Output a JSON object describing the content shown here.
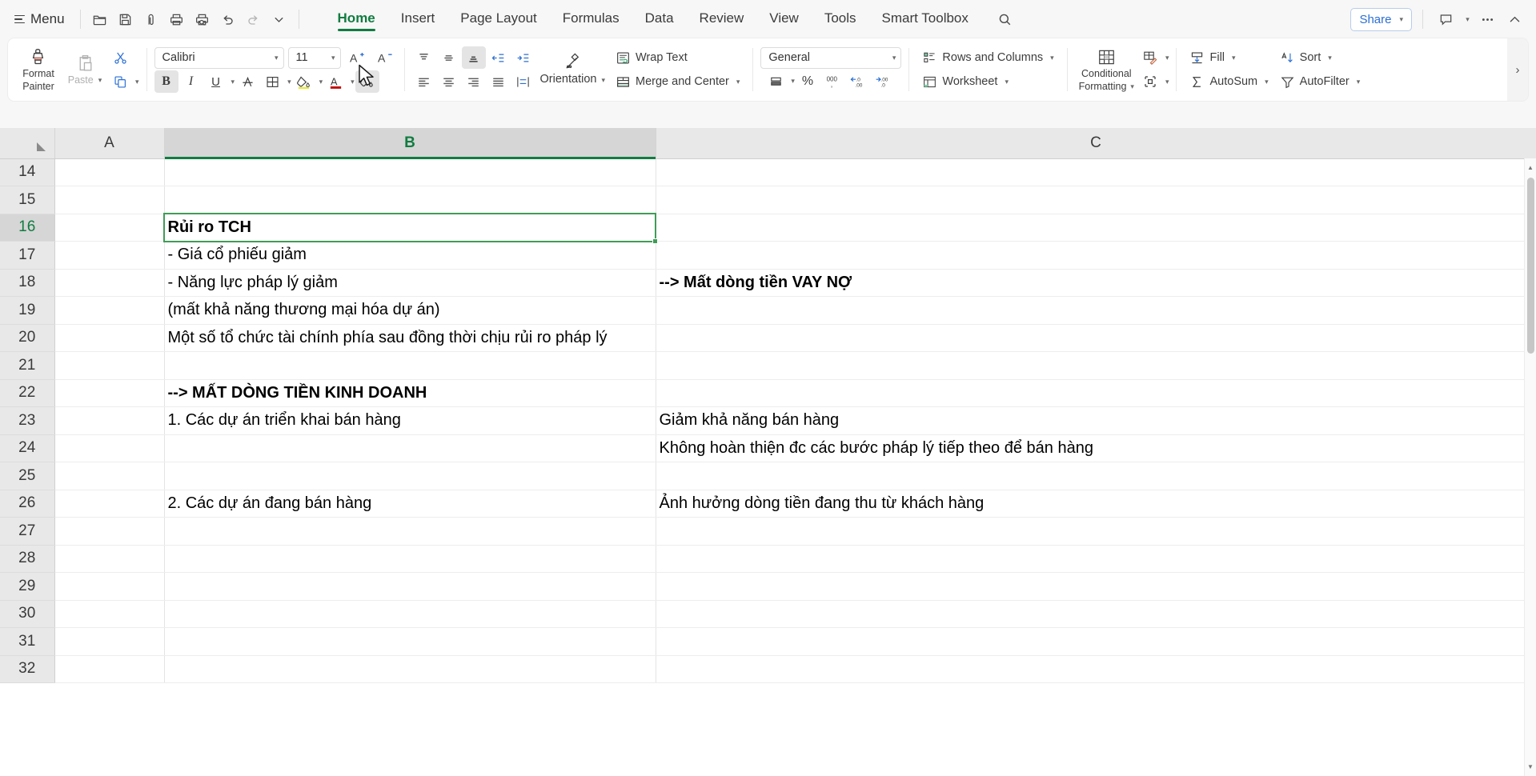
{
  "app": {
    "menu_label": "Menu",
    "share_label": "Share"
  },
  "quick_access": [
    {
      "name": "open-icon",
      "title": "Open"
    },
    {
      "name": "save-icon",
      "title": "Save"
    },
    {
      "name": "output-icon",
      "title": "Output as PDF"
    },
    {
      "name": "print-icon",
      "title": "Print"
    },
    {
      "name": "print-preview-icon",
      "title": "Print Preview"
    },
    {
      "name": "undo-icon",
      "title": "Undo"
    },
    {
      "name": "redo-icon",
      "title": "Redo"
    },
    {
      "name": "customize-icon",
      "title": "Customize Quick Access Toolbar"
    }
  ],
  "tabs": [
    {
      "label": "Home",
      "active": true
    },
    {
      "label": "Insert",
      "active": false
    },
    {
      "label": "Page Layout",
      "active": false
    },
    {
      "label": "Formulas",
      "active": false
    },
    {
      "label": "Data",
      "active": false
    },
    {
      "label": "Review",
      "active": false
    },
    {
      "label": "View",
      "active": false
    },
    {
      "label": "Tools",
      "active": false
    },
    {
      "label": "Smart Toolbox",
      "active": false
    }
  ],
  "ribbon": {
    "format_painter": "Format\nPainter",
    "format_painter_line1": "Format",
    "format_painter_line2": "Painter",
    "paste_label": "Paste",
    "font_name": "Calibri",
    "font_size": "11",
    "wrap_text": "Wrap Text",
    "orientation": "Orientation",
    "merge_and_center": "Merge and Center",
    "number_format": "General",
    "rows_and_columns": "Rows and Columns",
    "worksheet": "Worksheet",
    "conditional_formatting_line1": "Conditional",
    "conditional_formatting_line2": "Formatting",
    "fill": "Fill",
    "autosum": "AutoSum",
    "sort": "Sort",
    "autofilter": "AutoFilter",
    "expand_more": "›"
  },
  "sheet": {
    "columns": [
      "A",
      "B",
      "C"
    ],
    "selected_column": "B",
    "active_cell": "B16",
    "rows": [
      {
        "num": "14",
        "a": "",
        "b": "",
        "c": ""
      },
      {
        "num": "15",
        "a": "",
        "b": "",
        "c": ""
      },
      {
        "num": "16",
        "a": "",
        "b": "Rủi ro TCH",
        "c": "",
        "b_bold": true,
        "active": true
      },
      {
        "num": "17",
        "a": "",
        "b": "- Giá cổ phiếu giảm",
        "c": ""
      },
      {
        "num": "18",
        "a": "",
        "b": "- Năng lực pháp lý giảm",
        "c": "--> Mất dòng tiền VAY NỢ",
        "c_bold": true
      },
      {
        "num": "19",
        "a": "",
        "b": "(mất khả năng thương mại hóa dự án)",
        "c": ""
      },
      {
        "num": "20",
        "a": "",
        "b": "Một số tổ chức tài chính phía sau đồng thời chịu rủi ro pháp lý",
        "c": ""
      },
      {
        "num": "21",
        "a": "",
        "b": "",
        "c": ""
      },
      {
        "num": "22",
        "a": "",
        "b": "--> MẤT DÒNG TIỀN KINH DOANH",
        "c": "",
        "b_bold": true
      },
      {
        "num": "23",
        "a": "",
        "b": "1. Các dự án triển khai bán hàng",
        "c": "Giảm khả năng bán hàng"
      },
      {
        "num": "24",
        "a": "",
        "b": "",
        "c": "Không hoàn thiện đc các bước pháp lý tiếp theo để bán hàng"
      },
      {
        "num": "25",
        "a": "",
        "b": "",
        "c": ""
      },
      {
        "num": "26",
        "a": "",
        "b": "2. Các dự án đang bán hàng",
        "c": "Ảnh hưởng dòng tiền đang thu từ khách hàng"
      },
      {
        "num": "27",
        "a": "",
        "b": "",
        "c": ""
      },
      {
        "num": "28",
        "a": "",
        "b": "",
        "c": ""
      },
      {
        "num": "29",
        "a": "",
        "b": "",
        "c": ""
      },
      {
        "num": "30",
        "a": "",
        "b": "",
        "c": ""
      },
      {
        "num": "31",
        "a": "",
        "b": "",
        "c": ""
      },
      {
        "num": "32",
        "a": "",
        "b": "",
        "c": ""
      }
    ]
  },
  "colors": {
    "accent_green": "#107c41",
    "selection_green": "#3f9c57",
    "share_blue": "#2b6fd4",
    "header_gray": "#e8e8e8"
  }
}
